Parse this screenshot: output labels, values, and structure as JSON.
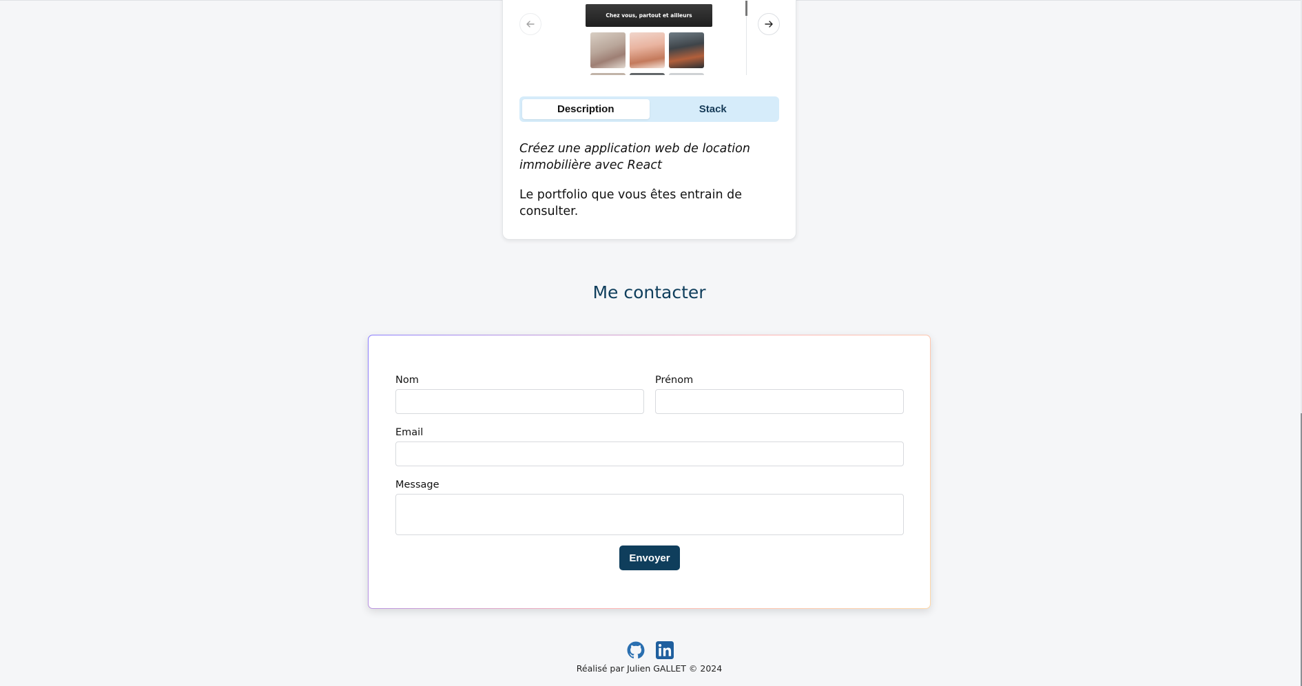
{
  "project": {
    "slide_banner": "Chez vous, partout et ailleurs",
    "tabs": [
      {
        "label": "Description",
        "active": true
      },
      {
        "label": "Stack",
        "active": false
      }
    ],
    "subtitle": "Créez une application web de location immobilière avec React",
    "description": "Le portfolio que vous êtes entrain de consulter."
  },
  "contact": {
    "title": "Me contacter",
    "fields": {
      "nom_label": "Nom",
      "prenom_label": "Prénom",
      "email_label": "Email",
      "message_label": "Message"
    },
    "submit_label": "Envoyer"
  },
  "footer": {
    "icons": [
      "github-icon",
      "linkedin-icon"
    ],
    "text": "Réalisé par Julien GALLET © 2024"
  },
  "colors": {
    "primary": "#0f3e5c",
    "tab_bg": "#d6ecfa",
    "page_bg": "#f5f6f8"
  }
}
